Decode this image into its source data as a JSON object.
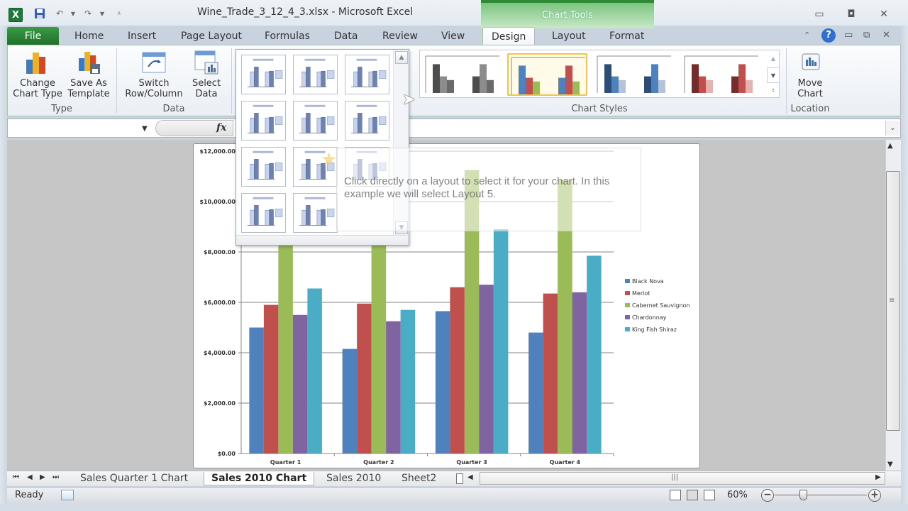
{
  "window": {
    "title": "Wine_Trade_3_12_4_3.xlsx  -  Microsoft Excel",
    "context_tab_group": "Chart Tools"
  },
  "tabs": {
    "file": "File",
    "home": "Home",
    "insert": "Insert",
    "page_layout": "Page Layout",
    "formulas": "Formulas",
    "data": "Data",
    "review": "Review",
    "view": "View",
    "design": "Design",
    "layout": "Layout",
    "format": "Format",
    "active": "Design"
  },
  "ribbon": {
    "type_group": {
      "label": "Type",
      "change_chart_type": [
        "Change",
        "Chart Type"
      ],
      "save_as_template": [
        "Save As",
        "Template"
      ]
    },
    "data_group": {
      "label": "Data",
      "switch_row_column": [
        "Switch",
        "Row/Column"
      ],
      "select_data": [
        "Select",
        "Data"
      ]
    },
    "chart_layouts": {
      "count": 11,
      "selected_hint": "Layout 5"
    },
    "chart_styles": {
      "label": "Chart Styles",
      "styles": [
        {
          "name": "monochrome-gray",
          "colors": [
            "#4d4d4d",
            "#8c8c8c",
            "#6a6a6a"
          ]
        },
        {
          "name": "colorful",
          "colors": [
            "#4f81bd",
            "#c0504d",
            "#9bbb59"
          ],
          "selected": true
        },
        {
          "name": "blue-shades",
          "colors": [
            "#2c4d75",
            "#4f81bd",
            "#b3c3dc"
          ]
        },
        {
          "name": "red-shades",
          "colors": [
            "#772c2a",
            "#c0504d",
            "#e1b4b3"
          ]
        }
      ]
    },
    "location_group": {
      "label": "Location",
      "move_chart": [
        "Move",
        "Chart"
      ]
    }
  },
  "formula_bar": {
    "name_box": "",
    "fx_label": "fx",
    "content": ""
  },
  "tooltip": {
    "text": "Click directly on a layout to select it for your chart. In this example we will select Layout 5."
  },
  "sheet_tabs": [
    "Sales Quarter 1 Chart",
    "Sales 2010 Chart",
    "Sales 2010",
    "Sheet2"
  ],
  "active_sheet": "Sales 2010 Chart",
  "status_bar": {
    "ready": "Ready",
    "zoom": "60%",
    "zoom_fraction": 0.6
  },
  "chart_data": {
    "type": "bar",
    "title": "",
    "xlabel": "",
    "ylabel": "",
    "categories": [
      "Quarter 1",
      "Quarter 2",
      "Quarter 3",
      "Quarter 4"
    ],
    "ylim": [
      0,
      12000
    ],
    "yticks": [
      "$0.00",
      "$2,000.00",
      "$4,000.00",
      "$6,000.00",
      "$8,000.00",
      "$10,000.00",
      "$12,000.00"
    ],
    "ytick_values": [
      0,
      2000,
      4000,
      6000,
      8000,
      10000,
      12000
    ],
    "grid": true,
    "legend": "right",
    "series": [
      {
        "name": "Black Nova",
        "color": "#4f81bd",
        "values": [
          5000,
          4150,
          5650,
          4800
        ]
      },
      {
        "name": "Merlot",
        "color": "#c0504d",
        "values": [
          5900,
          5950,
          6600,
          6350
        ]
      },
      {
        "name": "Cabernet Sauvignon",
        "color": "#9bbb59",
        "values": [
          9500,
          9200,
          11250,
          10850
        ]
      },
      {
        "name": "Chardonnay",
        "color": "#8064a2",
        "values": [
          5500,
          5250,
          6700,
          6400
        ]
      },
      {
        "name": "King Fish Shiraz",
        "color": "#4bacc6",
        "values": [
          6550,
          5700,
          8900,
          7850
        ]
      }
    ]
  }
}
